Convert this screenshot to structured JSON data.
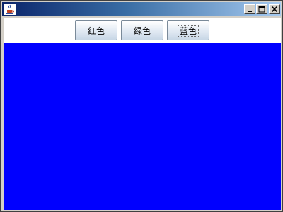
{
  "window": {
    "title": "",
    "icon": "java-cup-icon",
    "controls": {
      "minimize_icon": "minimize-icon",
      "maximize_icon": "maximize-icon",
      "close_icon": "close-icon"
    }
  },
  "buttons": {
    "red_label": "红色",
    "green_label": "绿色",
    "blue_label": "蓝色"
  },
  "colors": {
    "panel_background": "#0000ff",
    "button_bar_background": "#ffffff",
    "titlebar_start": "#0a246a",
    "titlebar_end": "#a6caf0"
  }
}
